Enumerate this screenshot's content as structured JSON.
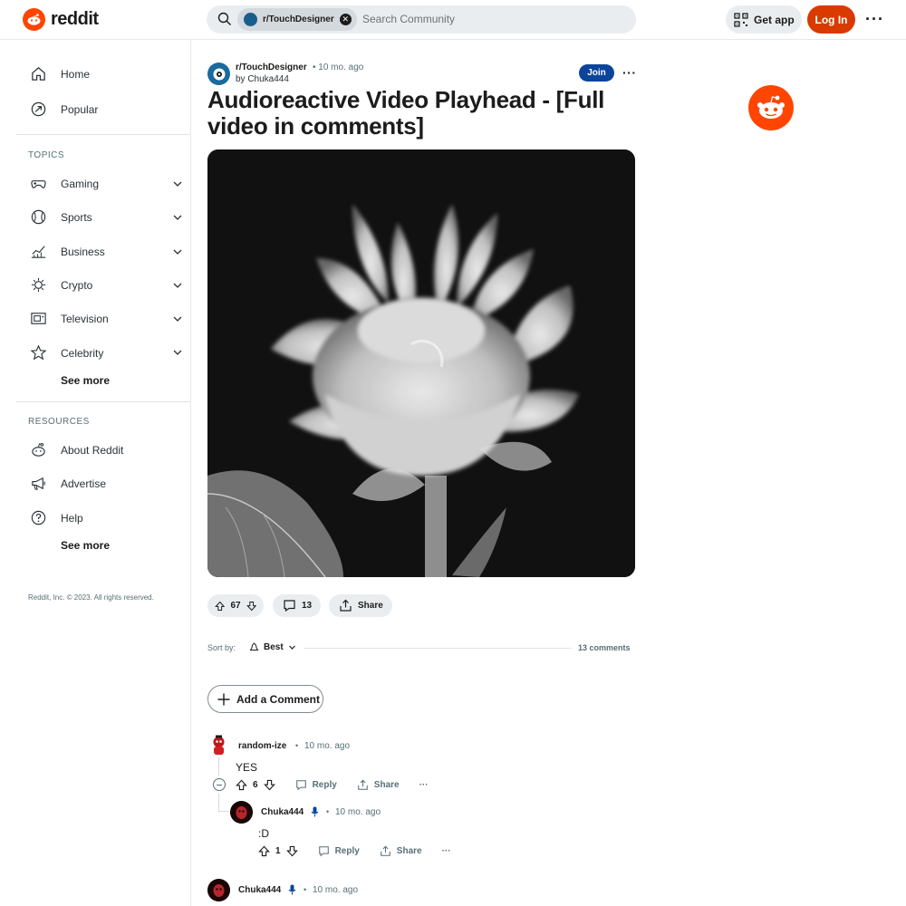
{
  "header": {
    "logo_text": "reddit",
    "search_chip": "r/TouchDesigner",
    "search_placeholder": "Search Community",
    "get_app": "Get app",
    "login": "Log In"
  },
  "sidebar": {
    "primary": [
      {
        "label": "Home",
        "icon": "home-icon"
      },
      {
        "label": "Popular",
        "icon": "popular-icon"
      }
    ],
    "topics_label": "TOPICS",
    "topics": [
      {
        "label": "Gaming",
        "icon": "gamepad-icon"
      },
      {
        "label": "Sports",
        "icon": "ball-icon"
      },
      {
        "label": "Business",
        "icon": "chart-icon"
      },
      {
        "label": "Crypto",
        "icon": "crypto-icon"
      },
      {
        "label": "Television",
        "icon": "tv-icon"
      },
      {
        "label": "Celebrity",
        "icon": "star-icon"
      }
    ],
    "see_more_1": "See more",
    "resources_label": "RESOURCES",
    "resources": [
      {
        "label": "About Reddit",
        "icon": "reddit-icon"
      },
      {
        "label": "Advertise",
        "icon": "megaphone-icon"
      },
      {
        "label": "Help",
        "icon": "help-icon"
      }
    ],
    "see_more_2": "See more",
    "footer": "Reddit, Inc. © 2023. All rights reserved."
  },
  "post": {
    "subreddit": "r/TouchDesigner",
    "time": "• 10 mo. ago",
    "by": "by Chuka444",
    "join": "Join",
    "title": "Audioreactive Video Playhead - [Full video in comments]",
    "votes": "67",
    "comments": "13",
    "share": "Share"
  },
  "sort": {
    "label": "Sort by:",
    "value": "Best",
    "count": "13 comments"
  },
  "add_comment": "Add a Comment",
  "comments": [
    {
      "user": "random-ize",
      "time": "10 mo. ago",
      "body": "YES",
      "votes": "6",
      "reply": "Reply",
      "share": "Share"
    },
    {
      "user": "Chuka444",
      "time": "10 mo. ago",
      "body": ":D",
      "votes": "1",
      "reply": "Reply",
      "share": "Share"
    },
    {
      "user": "Chuka444",
      "time": "10 mo. ago"
    }
  ],
  "colors": {
    "brand": "#ff4500",
    "login": "#d93a00",
    "join": "#0a449b"
  }
}
